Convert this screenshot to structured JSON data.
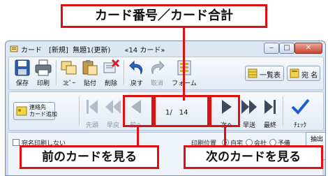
{
  "window": {
    "title": "カード　[新規]  無題1(更新)　　«14 カード»",
    "min_symbol": "‒",
    "max_symbol": "□",
    "close_symbol": "✕"
  },
  "toolbar": {
    "save": "保存",
    "print": "印刷",
    "copy": "ｺﾋﾟｰ",
    "paste": "貼付",
    "delete": "削除",
    "undo": "戻す",
    "redo": "取消",
    "form": "フォーム",
    "list_view": "一覧表",
    "address": "宛 名"
  },
  "nav": {
    "add_card": "連絡先\nカード追加",
    "first": "先頭",
    "fast_back": "早戻",
    "prev": "前へ",
    "counter": "1/　14",
    "next": "次へ",
    "fast_forward": "早送",
    "last": "最終",
    "check": "ﾁｪｯｸ"
  },
  "bottom": {
    "no_print_label": "宛名印刷しない",
    "print_position_label": "印刷位置",
    "home": "自宅",
    "company": "会社",
    "spare": "予備",
    "extract": "抽出"
  },
  "callouts": {
    "top": "カード番号／カード合計",
    "prev": "前のカードを見る",
    "next": "次のカードを見る"
  },
  "colors": {
    "callout_red": "#e01010",
    "window_frame": "#7a8fa8"
  }
}
